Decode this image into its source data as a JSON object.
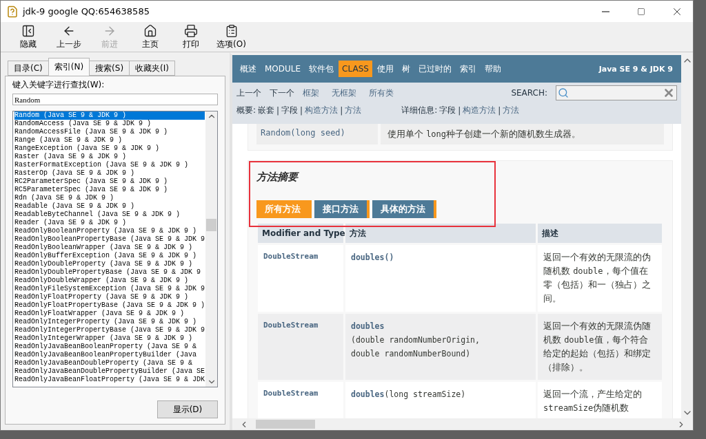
{
  "window": {
    "title": "jdk-9 google QQ:654638585"
  },
  "toolbar": [
    {
      "kind": "hide",
      "label": "隐藏",
      "disabled": false
    },
    {
      "kind": "back",
      "label": "上一步",
      "disabled": false
    },
    {
      "kind": "forward",
      "label": "前进",
      "disabled": true
    },
    {
      "kind": "home",
      "label": "主页",
      "disabled": false
    },
    {
      "kind": "print",
      "label": "打印",
      "disabled": false
    },
    {
      "kind": "options",
      "label": "选项(O)",
      "disabled": false
    }
  ],
  "left_pane": {
    "tabs": [
      {
        "label": "目录(C)",
        "selected": false
      },
      {
        "label": "索引(N)",
        "selected": true
      },
      {
        "label": "搜索(S)",
        "selected": false
      },
      {
        "label": "收藏夹(I)",
        "selected": false
      }
    ],
    "keyword_label": "键入关键字进行查找(W):",
    "keyword_field": {
      "value": "Random"
    },
    "index_list": [
      {
        "text": "Random (Java SE 9 & JDK 9 )",
        "selected": true
      },
      {
        "text": "RandomAccess (Java SE 9 & JDK 9 )",
        "selected": false
      },
      {
        "text": "RandomAccessFile (Java SE 9 & JDK 9 )",
        "selected": false
      },
      {
        "text": "Range (Java SE 9 & JDK 9 )",
        "selected": false
      },
      {
        "text": "RangeException (Java SE 9 & JDK 9 )",
        "selected": false
      },
      {
        "text": "Raster (Java SE 9 & JDK 9 )",
        "selected": false
      },
      {
        "text": "RasterFormatException (Java SE 9 & JDK 9 )",
        "selected": false
      },
      {
        "text": "RasterOp (Java SE 9 & JDK 9 )",
        "selected": false
      },
      {
        "text": "RC2ParameterSpec (Java SE 9 & JDK 9 )",
        "selected": false
      },
      {
        "text": "RC5ParameterSpec (Java SE 9 & JDK 9 )",
        "selected": false
      },
      {
        "text": "Rdn (Java SE 9 & JDK 9 )",
        "selected": false
      },
      {
        "text": "Readable (Java SE 9 & JDK 9 )",
        "selected": false
      },
      {
        "text": "ReadableByteChannel (Java SE 9 & JDK 9 )",
        "selected": false
      },
      {
        "text": "Reader (Java SE 9 & JDK 9 )",
        "selected": false
      },
      {
        "text": "ReadOnlyBooleanProperty (Java SE 9 & JDK 9 )",
        "selected": false
      },
      {
        "text": "ReadOnlyBooleanPropertyBase (Java SE 9 & JDK 9",
        "selected": false
      },
      {
        "text": "ReadOnlyBooleanWrapper (Java SE 9 & JDK 9 )",
        "selected": false
      },
      {
        "text": "ReadOnlyBufferException (Java SE 9 & JDK 9 )",
        "selected": false
      },
      {
        "text": "ReadOnlyDoubleProperty (Java SE 9 & JDK 9 )",
        "selected": false
      },
      {
        "text": "ReadOnlyDoublePropertyBase (Java SE 9 & JDK 9",
        "selected": false
      },
      {
        "text": "ReadOnlyDoubleWrapper (Java SE 9 & JDK 9 )",
        "selected": false
      },
      {
        "text": "ReadOnlyFileSystemException (Java SE 9 & JDK 9",
        "selected": false
      },
      {
        "text": "ReadOnlyFloatProperty (Java SE 9 & JDK 9 )",
        "selected": false
      },
      {
        "text": "ReadOnlyFloatPropertyBase (Java SE 9 & JDK 9 )",
        "selected": false
      },
      {
        "text": "ReadOnlyFloatWrapper (Java SE 9 & JDK 9 )",
        "selected": false
      },
      {
        "text": "ReadOnlyIntegerProperty (Java SE 9 & JDK 9 )",
        "selected": false
      },
      {
        "text": "ReadOnlyIntegerPropertyBase (Java SE 9 & JDK 9",
        "selected": false
      },
      {
        "text": "ReadOnlyIntegerWrapper (Java SE 9 & JDK 9 )",
        "selected": false
      },
      {
        "text": "ReadOnlyJavaBeanBooleanProperty (Java SE 9 &",
        "selected": false
      },
      {
        "text": "ReadOnlyJavaBeanBooleanPropertyBuilder (Java",
        "selected": false
      },
      {
        "text": "ReadOnlyJavaBeanDoubleProperty (Java SE 9 &",
        "selected": false
      },
      {
        "text": "ReadOnlyJavaBeanDoublePropertyBuilder (Java SE",
        "selected": false
      },
      {
        "text": "ReadOnlyJavaBeanFloatProperty (Java SE 9 & JDK",
        "selected": false
      }
    ],
    "display_button": "显示(D)"
  },
  "doc": {
    "nav": [
      {
        "label": "概述",
        "selected": false
      },
      {
        "label": "MODULE",
        "selected": false
      },
      {
        "label": "软件包",
        "selected": false
      },
      {
        "label": "CLASS",
        "selected": true
      },
      {
        "label": "使用",
        "selected": false
      },
      {
        "label": "树",
        "selected": false
      },
      {
        "label": "已过时的",
        "selected": false
      },
      {
        "label": "索引",
        "selected": false
      },
      {
        "label": "帮助",
        "selected": false
      }
    ],
    "nav_title": "Java SE 9 & JDK 9",
    "subnav_links": [
      {
        "label": "上一个",
        "link": false
      },
      {
        "label": "下一个",
        "link": false
      },
      {
        "label": "框架",
        "link": true
      },
      {
        "label": "无框架",
        "link": true
      },
      {
        "label": "所有类",
        "link": true
      }
    ],
    "search_label": "SEARCH:",
    "separator": "|",
    "summary_label": "概要:",
    "summary_links": [
      {
        "label": "嵌套",
        "link": false
      },
      {
        "label": "字段",
        "link": false
      },
      {
        "label": "构造方法",
        "link": true
      },
      {
        "label": "方法",
        "link": true
      }
    ],
    "detail_label": "详细信息:",
    "detail_links": [
      {
        "label": "字段",
        "link": false
      },
      {
        "label": "构造方法",
        "link": true
      },
      {
        "label": "方法",
        "link": true
      }
    ],
    "constructor_row": {
      "signature": "Random(long seed)",
      "description": [
        {
          "text": "使用单个 ",
          "code": false
        },
        {
          "text": "long",
          "code": true
        },
        {
          "text": "种子创建一个新的随机数生成器。",
          "code": false
        }
      ]
    },
    "method_summary": {
      "heading": "方法摘要",
      "tabs": [
        {
          "label": "所有方法",
          "selected": true
        },
        {
          "label": "接口方法",
          "selected": false
        },
        {
          "label": "具体的方法",
          "selected": false
        }
      ],
      "columns": [
        "Modifier and Type",
        "方法",
        "描述"
      ],
      "rows": [
        {
          "type": "DoubleStream",
          "method": {
            "name": "doubles()"
          },
          "description": [
            {
              "text": "返回一个有效的无限流的伪随机数 ",
              "code": false
            },
            {
              "text": "double",
              "code": true
            },
            {
              "text": "，每个值在零（包括）和一（独占）之间。",
              "code": false
            }
          ]
        },
        {
          "type": "DoubleStream",
          "method": {
            "name": "doubles",
            "params": [
              "(double randomNumberOrigin,",
              "double randomNumberBound)"
            ]
          },
          "description": [
            {
              "text": "返回一个有效的无限流伪随机数 ",
              "code": false
            },
            {
              "text": "double",
              "code": true
            },
            {
              "text": "值，每个符合给定的起始（包括）和绑定（排除）。",
              "code": false
            }
          ]
        },
        {
          "type": "DoubleStream",
          "method": {
            "name": "doubles",
            "params": "(long streamSize)"
          },
          "description": [
            {
              "text": "返回一个流，产生给定的",
              "code": false
            },
            {
              "text": "streamSize",
              "code": true
            },
            {
              "text": "伪随机数",
              "code": false
            }
          ]
        }
      ]
    }
  }
}
